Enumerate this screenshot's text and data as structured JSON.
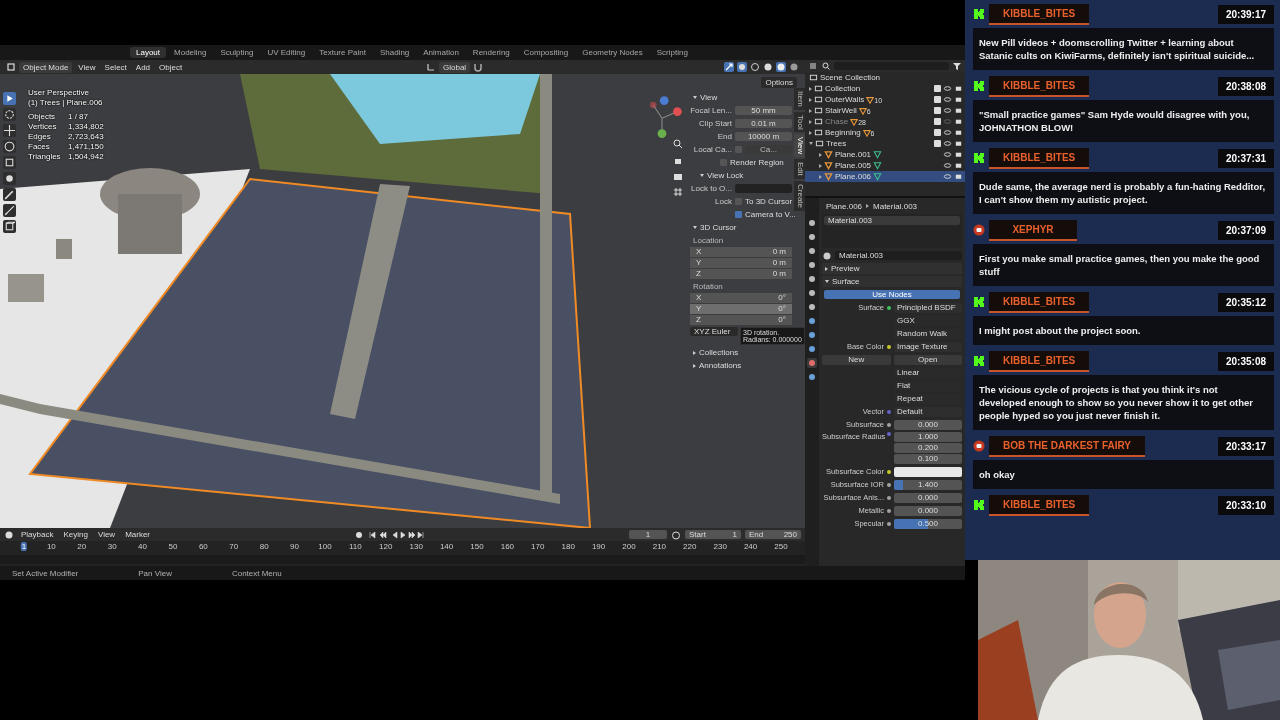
{
  "topbar": {
    "tabs": [
      {
        "label": "Layout",
        "selected": true
      },
      {
        "label": "Modeling",
        "selected": false
      },
      {
        "label": "Sculpting",
        "selected": false
      },
      {
        "label": "UV Editing",
        "selected": false
      },
      {
        "label": "Texture Paint",
        "selected": false
      },
      {
        "label": "Shading",
        "selected": false
      },
      {
        "label": "Animation",
        "selected": false
      },
      {
        "label": "Rendering",
        "selected": false
      },
      {
        "label": "Compositing",
        "selected": false
      },
      {
        "label": "Geometry Nodes",
        "selected": false
      },
      {
        "label": "Scripting",
        "selected": false
      }
    ]
  },
  "viewport_header": {
    "mode": "Object Mode",
    "menus": [
      "View",
      "Select",
      "Add",
      "Object"
    ],
    "orientation": "Global",
    "options": "Options"
  },
  "viewport": {
    "perspective": "User Perspective",
    "context": "(1) Trees | Plane.006",
    "stats": [
      {
        "label": "Objects",
        "value": "1 / 87"
      },
      {
        "label": "Vertices",
        "value": "1,334,802"
      },
      {
        "label": "Edges",
        "value": "2,723,643"
      },
      {
        "label": "Faces",
        "value": "1,471,150"
      },
      {
        "label": "Triangles",
        "value": "1,504,942"
      }
    ]
  },
  "n_panel": {
    "tabs": [
      {
        "label": "Item",
        "selected": false
      },
      {
        "label": "Tool",
        "selected": false
      },
      {
        "label": "View",
        "selected": true
      },
      {
        "label": "Edit",
        "selected": false
      },
      {
        "label": "Create",
        "selected": false
      }
    ],
    "view": {
      "title": "View",
      "expanded": true,
      "fields": [
        {
          "label": "Focal Len...",
          "value": "50 mm"
        },
        {
          "label": "Clip Start",
          "value": "0.01 m"
        },
        {
          "label": "End",
          "value": "10000 m"
        }
      ],
      "local_camera": {
        "label": "Local Ca...",
        "checked": false,
        "value": "Ca..."
      },
      "render_region": {
        "label": "Render Region",
        "checked": false
      }
    },
    "view_lock": {
      "title": "View Lock",
      "expanded": true,
      "lock_to": "Lock to O...",
      "lock_label": "Lock",
      "checks": [
        {
          "label": "To 3D Cursor",
          "checked": false
        },
        {
          "label": "Camera to V...",
          "checked": true
        }
      ]
    },
    "cursor": {
      "title": "3D Cursor",
      "expanded": true,
      "location_label": "Location",
      "location": [
        {
          "axis": "X",
          "value": "0 m"
        },
        {
          "axis": "Y",
          "value": "0 m"
        },
        {
          "axis": "Z",
          "value": "0 m"
        }
      ],
      "rotation_label": "Rotation",
      "rotation": [
        {
          "axis": "X",
          "value": "0°",
          "selected": false
        },
        {
          "axis": "Y",
          "value": "0°",
          "selected": true
        },
        {
          "axis": "Z",
          "value": "0°",
          "selected": false
        }
      ],
      "mode": "XYZ Euler"
    },
    "tooltip": [
      "3D rotation.",
      "Radians: 0.000000"
    ],
    "sections": [
      {
        "title": "Collections",
        "expanded": false
      },
      {
        "title": "Annotations",
        "expanded": false
      }
    ]
  },
  "timeline": {
    "menus": [
      "Playback",
      "Keying",
      "View",
      "Marker"
    ],
    "frame": "1",
    "start_label": "Start",
    "start": "1",
    "end_label": "End",
    "end": "250",
    "ticks": [
      {
        "label": "1",
        "selected": true
      },
      {
        "label": "10",
        "selected": false
      },
      {
        "label": "20",
        "selected": false
      },
      {
        "label": "30",
        "selected": false
      },
      {
        "label": "40",
        "selected": false
      },
      {
        "label": "50",
        "selected": false
      },
      {
        "label": "60",
        "selected": false
      },
      {
        "label": "70",
        "selected": false
      },
      {
        "label": "80",
        "selected": false
      },
      {
        "label": "90",
        "selected": false
      },
      {
        "label": "100",
        "selected": false
      },
      {
        "label": "110",
        "selected": false
      },
      {
        "label": "120",
        "selected": false
      },
      {
        "label": "130",
        "selected": false
      },
      {
        "label": "140",
        "selected": false
      },
      {
        "label": "150",
        "selected": false
      },
      {
        "label": "160",
        "selected": false
      },
      {
        "label": "170",
        "selected": false
      },
      {
        "label": "180",
        "selected": false
      },
      {
        "label": "190",
        "selected": false
      },
      {
        "label": "200",
        "selected": false
      },
      {
        "label": "210",
        "selected": false
      },
      {
        "label": "220",
        "selected": false
      },
      {
        "label": "230",
        "selected": false
      },
      {
        "label": "240",
        "selected": false
      },
      {
        "label": "250",
        "selected": false
      }
    ]
  },
  "status_bar": [
    "Set Active Modifier",
    "Pan View",
    "Context Menu"
  ],
  "outliner": {
    "root": "Scene Collection",
    "items": [
      {
        "name": "Collection",
        "checked": true,
        "disabled": false,
        "expanded": false,
        "selected": false
      },
      {
        "name": "OuterWalls",
        "count": "10",
        "checked": true,
        "disabled": false,
        "expanded": false,
        "selected": false
      },
      {
        "name": "StairWell",
        "count": "6",
        "checked": true,
        "disabled": false,
        "expanded": false,
        "selected": false
      },
      {
        "name": "Chase",
        "count": "28",
        "checked": true,
        "disabled": true,
        "expanded": false,
        "selected": false
      },
      {
        "name": "Beginning",
        "count": "6",
        "checked": true,
        "disabled": false,
        "expanded": false,
        "selected": false
      },
      {
        "name": "Trees",
        "checked": true,
        "disabled": false,
        "expanded": true,
        "selected": false,
        "children": [
          {
            "name": "Plane.001",
            "selected": false
          },
          {
            "name": "Plane.005",
            "selected": false
          },
          {
            "name": "Plane.006",
            "selected": true
          }
        ]
      }
    ]
  },
  "properties": {
    "breadcrumb": [
      "Plane.006",
      "Material.003"
    ],
    "slots": [
      "Material.003"
    ],
    "material": "Material.003",
    "panels": [
      {
        "title": "Preview",
        "expanded": false
      },
      {
        "title": "Surface",
        "expanded": true
      }
    ],
    "use_nodes": "Use Nodes",
    "rows": [
      {
        "kind": "link",
        "label": "Surface",
        "value": "Principled BSDF",
        "color": "#3fbf5f"
      },
      {
        "kind": "dropdown",
        "value": "GGX"
      },
      {
        "kind": "dropdown",
        "value": "Random Walk"
      },
      {
        "kind": "link",
        "label": "Base Color",
        "value": "Image Texture",
        "color": "#c7c729"
      },
      {
        "new": "New",
        "open": "Open"
      },
      {
        "kind": "dropdown",
        "value": "Linear"
      },
      {
        "kind": "dropdown",
        "value": "Flat"
      },
      {
        "kind": "dropdown",
        "value": "Repeat"
      },
      {
        "kind": "link",
        "label": "Vector",
        "value": "Default",
        "color": "#6363c7"
      },
      {
        "kind": "number",
        "label": "Subsurface",
        "value": "0.000",
        "level": 0,
        "color": "#a1a1a1"
      },
      {
        "kind": "vector",
        "label": "Subsurface Radius",
        "values": [
          "1.000",
          "0.200",
          "0.100"
        ],
        "color": "#6363c7"
      },
      {
        "kind": "swatch",
        "label": "Subsurface Color",
        "color": "#c7c729",
        "swatch": {
          "color": "#e8e8e8"
        }
      },
      {
        "kind": "number",
        "label": "Subsurface IOR",
        "value": "1.400",
        "level": 0.13,
        "color": "#a1a1a1"
      },
      {
        "kind": "number",
        "label": "Subsurface Anis...",
        "value": "0.000",
        "level": 0,
        "color": "#a1a1a1"
      },
      {
        "kind": "number",
        "label": "Metallic",
        "value": "0.000",
        "level": 0,
        "color": "#a1a1a1"
      },
      {
        "kind": "number",
        "label": "Specular",
        "value": "0.500",
        "level": 0.5,
        "color": "#a1a1a1"
      }
    ]
  },
  "chat": [
    {
      "kind": "kick",
      "name": "KIBBLE_BITES",
      "time": "20:39:17",
      "text": "New Pill videos + doomscrolling Twitter + learning about Satanic cults on KiwiFarms, definitely isn't spiritual suicide..."
    },
    {
      "kind": "kick",
      "name": "KIBBLE_BITES",
      "time": "20:38:08",
      "text": "\"Small practice games\" Sam Hyde would disagree with you, JOHNATHON BLOW!"
    },
    {
      "kind": "kick",
      "name": "KIBBLE_BITES",
      "time": "20:37:31",
      "text": "Dude same, the average nerd is probably a fun-hating Redditor, I can't show them my autistic project."
    },
    {
      "kind": "youtube",
      "name": "XEPHYR",
      "time": "20:37:09",
      "text": "First you make small practice games, then you make the good stuff"
    },
    {
      "kind": "kick",
      "name": "KIBBLE_BITES",
      "time": "20:35:12",
      "text": "I might post about the project soon."
    },
    {
      "kind": "kick",
      "name": "KIBBLE_BITES",
      "time": "20:35:08",
      "text": "The vicious cycle of projects is that you think it's not developed enough to show so you never show it to get other people hyped so you just never finish it."
    },
    {
      "kind": "youtube",
      "name": "BOB THE DARKEST FAIRY",
      "time": "20:33:17",
      "text": "oh okay"
    },
    {
      "kind": "kick",
      "name": "KIBBLE_BITES",
      "time": "20:33:10"
    }
  ],
  "webcam": {
    "kind": "picture"
  }
}
